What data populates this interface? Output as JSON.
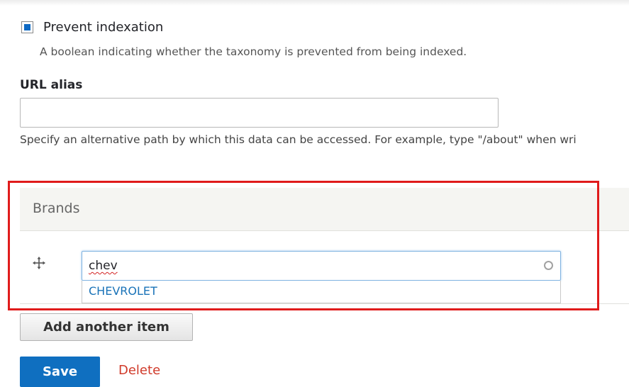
{
  "prevent_indexation": {
    "label": "Prevent indexation",
    "checked": true,
    "description": "A boolean indicating whether the taxonomy is prevented from being indexed."
  },
  "url_alias": {
    "label": "URL alias",
    "value": "",
    "description": "Specify an alternative path by which this data can be accessed. For example, type \"/about\" when wri"
  },
  "brands": {
    "title": "Brands",
    "item_value": "chev",
    "suggestions": [
      "CHEVROLET"
    ],
    "add_another_label": "Add another item"
  },
  "actions": {
    "save_label": "Save",
    "delete_label": "Delete"
  },
  "colors": {
    "primary": "#0f6fc0",
    "danger": "#d03a2a",
    "highlight": "#e01b1b",
    "link": "#1a73b8"
  }
}
